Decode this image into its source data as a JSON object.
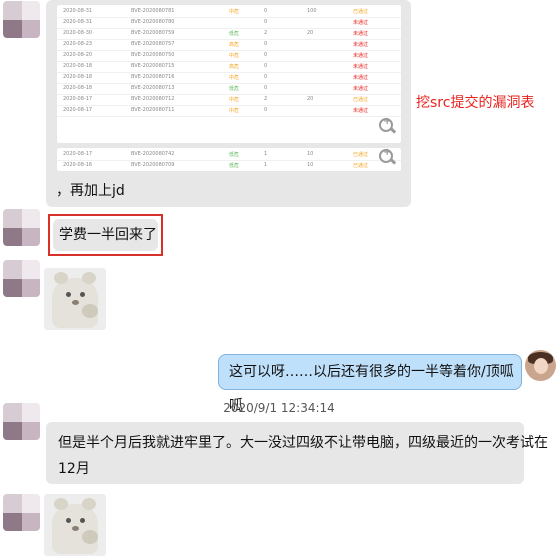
{
  "messages": {
    "first": {
      "suffix_text": "，再加上jd",
      "table_rows": [
        {
          "date": "2020-08-31",
          "id": "BVE-2020080781",
          "type": "中危",
          "count": "0",
          "score": "100",
          "status": "已通过"
        },
        {
          "date": "2020-08-31",
          "id": "BVE-2020080780",
          "type": "",
          "count": "0",
          "score": "",
          "status": "未通过"
        },
        {
          "date": "2020-08-30",
          "id": "BVE-2020080759",
          "type": "低危",
          "count": "2",
          "score": "20",
          "status": "未通过"
        },
        {
          "date": "2020-08-23",
          "id": "BVE-2020080757",
          "type": "高危",
          "count": "0",
          "score": "",
          "status": "未通过"
        },
        {
          "date": "2020-08-20",
          "id": "BVE-2020080750",
          "type": "中危",
          "count": "0",
          "score": "",
          "status": "未通过"
        },
        {
          "date": "2020-08-18",
          "id": "BVE-2020080715",
          "type": "高危",
          "count": "0",
          "score": "",
          "status": "未通过"
        },
        {
          "date": "2020-08-18",
          "id": "BVE-2020080716",
          "type": "中危",
          "count": "0",
          "score": "",
          "status": "未通过"
        },
        {
          "date": "2020-08-18",
          "id": "BVE-2020080713",
          "type": "低危",
          "count": "0",
          "score": "",
          "status": "未通过"
        },
        {
          "date": "2020-08-17",
          "id": "BVE-2020080712",
          "type": "中危",
          "count": "2",
          "score": "20",
          "status": "已通过"
        },
        {
          "date": "2020-08-17",
          "id": "BVE-2020080711",
          "type": "中危",
          "count": "0",
          "score": "",
          "status": "未通过"
        }
      ],
      "table_rows_2": [
        {
          "date": "2020-08-17",
          "id": "BVE-2020080742",
          "type": "低危",
          "count": "1",
          "score": "10",
          "status": "已通过"
        },
        {
          "date": "2020-08-16",
          "id": "BVE-2020080709",
          "type": "低危",
          "count": "1",
          "score": "10",
          "status": "已通过"
        }
      ]
    },
    "annotation": "挖src提交的漏洞表",
    "second": "学费一半回来了",
    "outgoing": "这可以呀……以后还有很多的一半等着你/顶呱呱",
    "timestamp": "2020/9/1 12:34:14",
    "third_line1": "但是半个月后我就进牢里了。大一没过四级不让带电脑，四级最近的一次考试在",
    "third_line2": "12月"
  },
  "colors": {
    "incoming_bubble": "#e7e7e7",
    "outgoing_bubble": "#bfe0fa",
    "annotation_red": "#e8231f",
    "status_pass": "#f5a623",
    "status_fail": "#e8231f",
    "type_green": "#5cb85c",
    "type_orange": "#f5a623"
  },
  "icons": [
    "zoom-in-icon",
    "avatar-image",
    "sticker-image"
  ]
}
